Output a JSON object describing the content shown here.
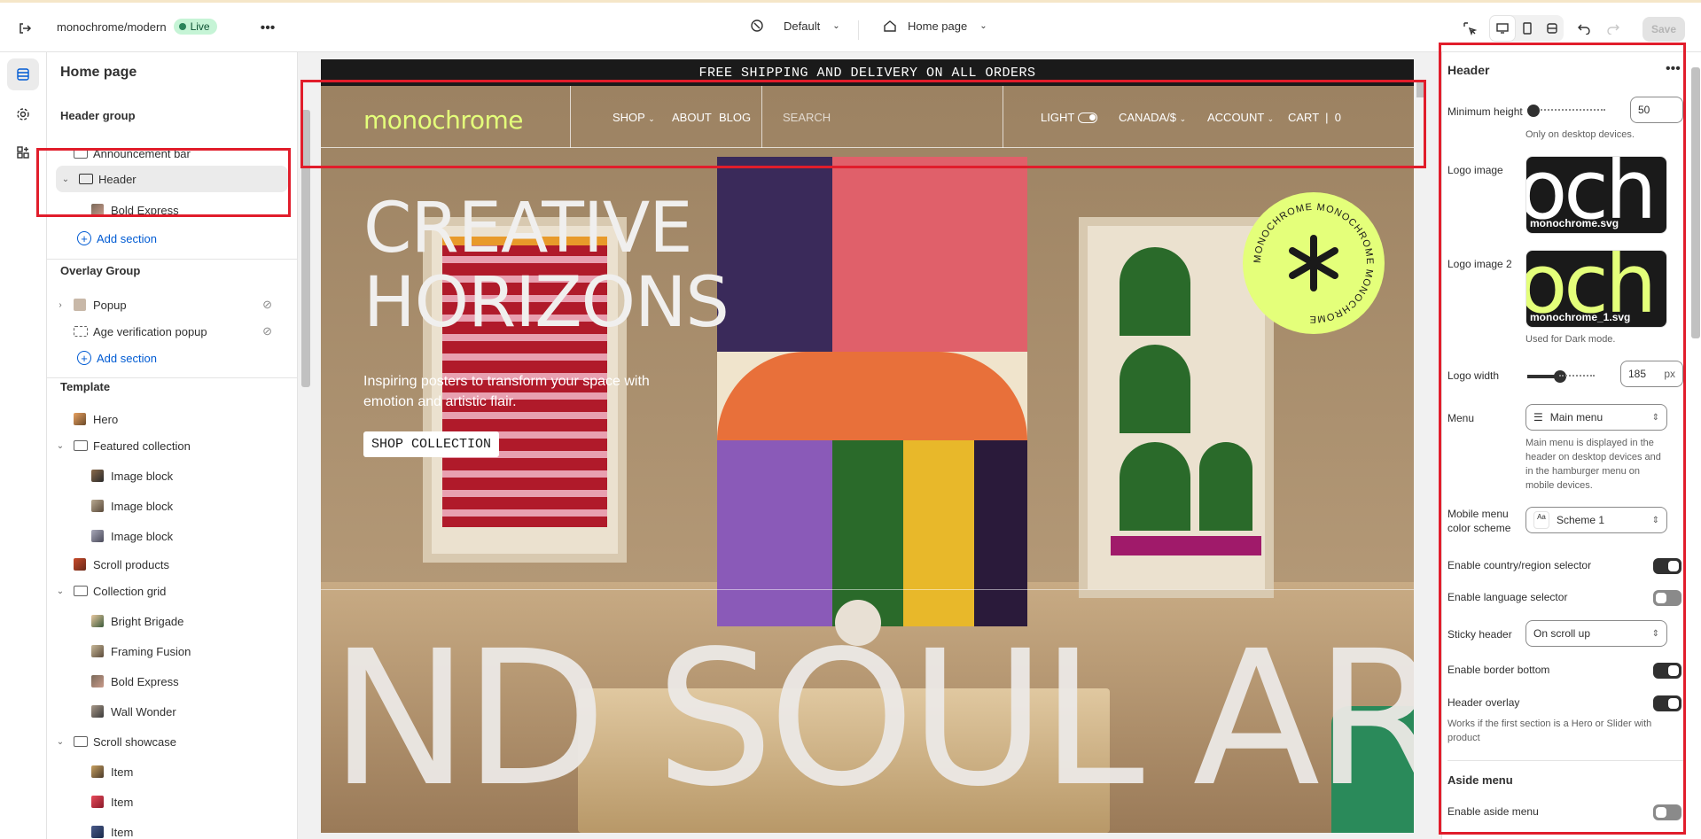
{
  "topbar": {
    "store_name": "monochrome/modern",
    "live_label": "Live",
    "theme_select": "Default",
    "page_select": "Home page",
    "save_label": "Save"
  },
  "sidebar": {
    "title": "Home page",
    "header_group": {
      "label": "Header group",
      "items": [
        {
          "label": "Announcement bar"
        },
        {
          "label": "Header"
        },
        {
          "label": "Bold Express"
        }
      ],
      "add_label": "Add section"
    },
    "overlay_group": {
      "label": "Overlay Group",
      "items": [
        {
          "label": "Popup"
        },
        {
          "label": "Age verification popup"
        }
      ],
      "add_label": "Add section"
    },
    "template": {
      "label": "Template",
      "items": [
        {
          "label": "Hero"
        },
        {
          "label": "Featured collection"
        },
        {
          "label": "Image block"
        },
        {
          "label": "Image block"
        },
        {
          "label": "Image block"
        },
        {
          "label": "Scroll products"
        },
        {
          "label": "Collection grid"
        },
        {
          "label": "Bright Brigade"
        },
        {
          "label": "Framing Fusion"
        },
        {
          "label": "Bold Express"
        },
        {
          "label": "Wall Wonder"
        },
        {
          "label": "Scroll showcase"
        },
        {
          "label": "Item"
        },
        {
          "label": "Item"
        },
        {
          "label": "Item"
        }
      ]
    }
  },
  "preview": {
    "announcement": "FREE SHIPPING AND DELIVERY ON ALL ORDERS",
    "logo": "monochrome",
    "nav": {
      "shop": "SHOP",
      "about": "ABOUT",
      "blog": "BLOG",
      "search_placeholder": "SEARCH",
      "light": "LIGHT",
      "currency": "CANADA/$",
      "account": "ACCOUNT",
      "cart": "CART",
      "cart_count": "0"
    },
    "hero_line1": "CREATIVE",
    "hero_line2": "HORIZONS",
    "hero_subtitle": "Inspiring posters to transform your space with emotion and artistic flair.",
    "hero_button": "SHOP COLLECTION",
    "marquee": "ND SOUL   ART",
    "badge_text": "MONOCHROME MONOCHROME MONOCHROME"
  },
  "settings": {
    "title": "Header",
    "min_height_label": "Minimum height",
    "min_height_value": "50",
    "min_height_help": "Only on desktop devices.",
    "logo_image_label": "Logo image",
    "logo_image_file": "monochrome.svg",
    "logo_image2_label": "Logo image 2",
    "logo_image2_file": "monochrome_1.svg",
    "logo_image2_help": "Used for Dark mode.",
    "logo_width_label": "Logo width",
    "logo_width_value": "185",
    "logo_width_unit": "px",
    "menu_label": "Menu",
    "menu_value": "Main menu",
    "menu_help": "Main menu is displayed in the header on desktop devices and in the hamburger menu on mobile devices.",
    "mobile_scheme_label": "Mobile menu color scheme",
    "mobile_scheme_value": "Scheme 1",
    "scheme_icon_text": "Aa",
    "country_selector_label": "Enable country/region selector",
    "language_selector_label": "Enable language selector",
    "sticky_label": "Sticky header",
    "sticky_value": "On scroll up",
    "border_bottom_label": "Enable border bottom",
    "overlay_label": "Header overlay",
    "overlay_help": "Works if the first section is a Hero or Slider with product",
    "aside_title": "Aside menu",
    "aside_enable_label": "Enable aside menu"
  },
  "toggles": {
    "country_selector": true,
    "language_selector": false,
    "border_bottom": true,
    "header_overlay": true,
    "aside_menu": false
  },
  "colors": {
    "accent_lime": "#e4ff7a",
    "highlight_red": "#e11d2b",
    "link_blue": "#005bd3",
    "live_green": "#29845a"
  }
}
